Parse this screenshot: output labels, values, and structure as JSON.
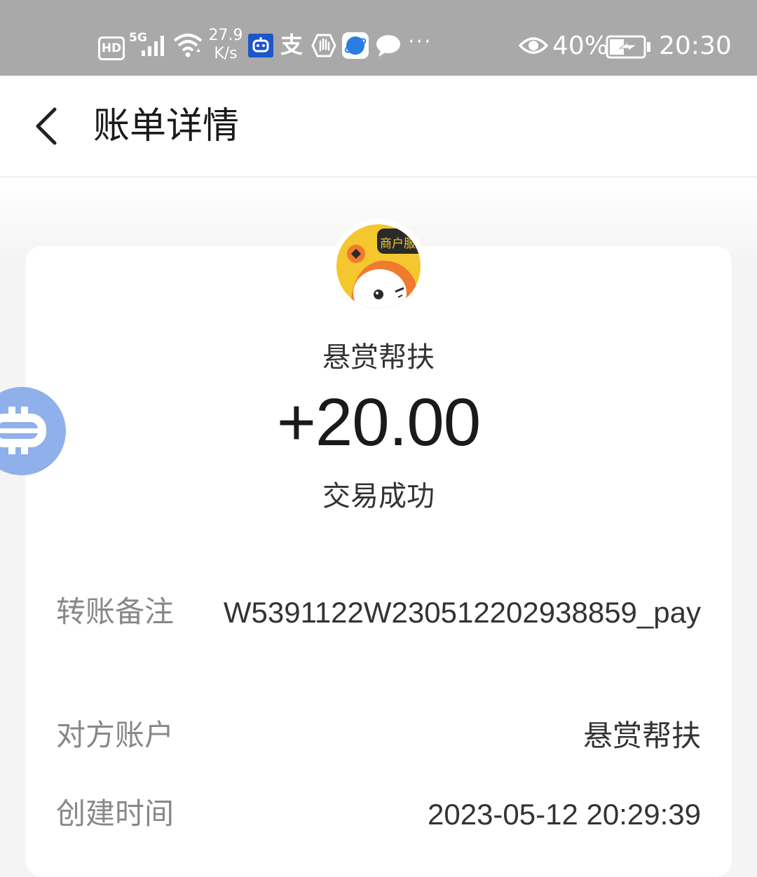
{
  "status_bar": {
    "hd": "HD",
    "network": "5G",
    "net_speed_value": "27.9",
    "net_speed_unit": "K/s",
    "battery": "40%",
    "time": "20:30",
    "more": "···",
    "icons": [
      "hd-icon",
      "signal-icon",
      "wifi-icon",
      "robot-app-icon",
      "alipay-icon",
      "hand-icon",
      "browser-icon",
      "chat-icon",
      "eye-icon",
      "battery-charging-icon"
    ]
  },
  "header": {
    "title": "账单详情",
    "back_icon": "chevron-left-icon"
  },
  "merchant": {
    "avatar_badge": "商户服",
    "name": "悬赏帮扶"
  },
  "transaction": {
    "amount": "+20.00",
    "status": "交易成功"
  },
  "details": [
    {
      "label": "转账备注",
      "value": "W5391122W230512202938859_pay"
    },
    {
      "label": "对方账户",
      "value": "悬赏帮扶"
    },
    {
      "label": "创建时间",
      "value": "2023-05-12 20:29:39"
    }
  ],
  "colors": {
    "status_bar_bg": "#a9a9a9",
    "float_button": "#8fb0ea",
    "avatar_bg": "#f5c72e",
    "avatar_accent": "#f07a2e"
  }
}
